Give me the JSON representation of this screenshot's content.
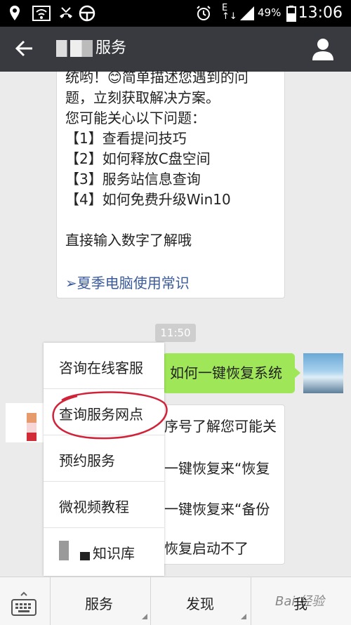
{
  "status_bar": {
    "battery": "49%",
    "time": "13:06"
  },
  "header": {
    "title": "服务"
  },
  "message_1": {
    "lines": "统哟！😊简单描述您遇到的问\n题，立刻获取解决方案。\n您可能关心以下问题：\n【1】查看提问技巧\n【2】如何释放C盘空间\n【3】服务站信息查询\n【4】如何免费升级Win10\n\n直接输入数字了解哦",
    "link": "➢夏季电脑使用常识"
  },
  "timestamp": "11:50",
  "sent_message": "如何一键恢复系统",
  "message_2": {
    "line1": "序号了解您可能关",
    "line2": "一键恢复来“恢复",
    "line3": "一键恢复来“备份",
    "line4": "恢复启动不了"
  },
  "popup_menu": {
    "items": [
      "咨询在线客服",
      "查询服务网点",
      "预约服务",
      "微视频教程",
      "知识库"
    ],
    "highlighted": "查询服务网点"
  },
  "bottom_bar": {
    "tabs": [
      "服务",
      "发现",
      "我"
    ],
    "watermark": "Bai 经验"
  },
  "colors": {
    "header": "#393a3f",
    "sent_bubble": "#9fe658",
    "annotation": "#d0233a",
    "link": "#3b5a9a"
  }
}
